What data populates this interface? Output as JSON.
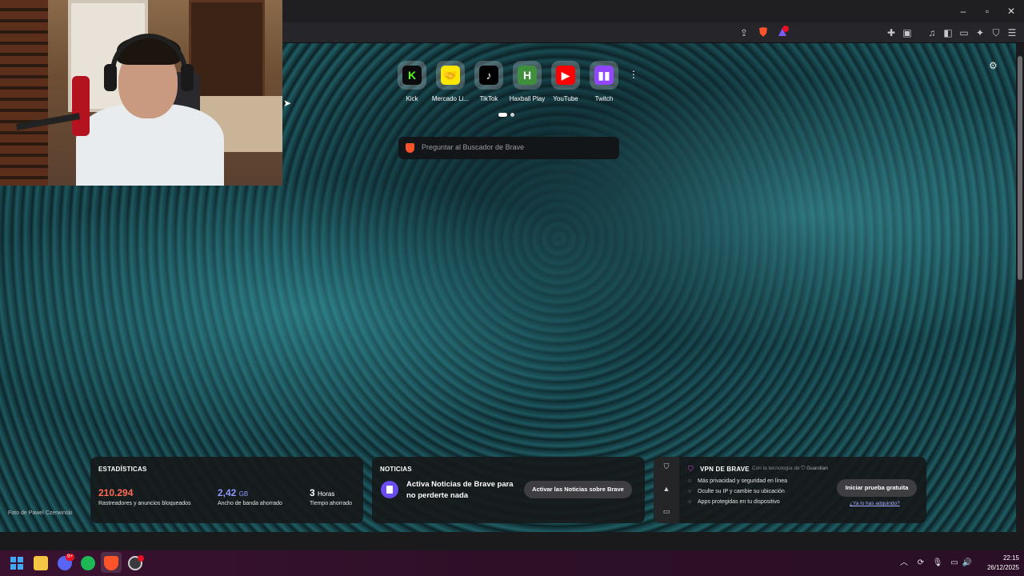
{
  "top_sites": [
    {
      "label": "Kick",
      "icon": "kick-icon",
      "glyph": "K",
      "color": "#53fc18",
      "bg": "#0b0b0b"
    },
    {
      "label": "Mercado Li...",
      "icon": "mercado-libre-icon",
      "glyph": "🤝",
      "color": "#2d3277",
      "bg": "#ffe600"
    },
    {
      "label": "TikTok",
      "icon": "tiktok-icon",
      "glyph": "♪",
      "color": "#ffffff",
      "bg": "#000000"
    },
    {
      "label": "Haxball Play",
      "icon": "haxball-icon",
      "glyph": "H",
      "color": "#ffffff",
      "bg": "#3f8f3c"
    },
    {
      "label": "YouTube",
      "icon": "youtube-icon",
      "glyph": "▶",
      "color": "#ffffff",
      "bg": "#ff0000"
    },
    {
      "label": "Twitch",
      "icon": "twitch-icon",
      "glyph": "▮▮",
      "color": "#ffffff",
      "bg": "#9146ff"
    }
  ],
  "search": {
    "placeholder": "Preguntar al Buscador de Brave"
  },
  "stats": {
    "title": "ESTADÍSTICAS",
    "blocked_value": "210.294",
    "blocked_label": "Rastreadores y anuncios bloqueados",
    "bandwidth_value": "2,42",
    "bandwidth_unit": "GB",
    "bandwidth_label": "Ancho de banda ahorrado",
    "time_value": "3",
    "time_unit": "Horas",
    "time_label": "Tiempo ahorrado",
    "colors": {
      "blocked": "#ff6b55",
      "bandwidth": "#8e98ff",
      "time": "#ffffff"
    }
  },
  "news": {
    "title": "NOTICIAS",
    "message": "Activa Noticias de Brave para no perderte nada",
    "button": "Activar las Noticias sobre Brave"
  },
  "vpn": {
    "title": "VPN DE BRAVE",
    "powered_by": "Con la tecnología de",
    "partner": "Guardian",
    "features": [
      "Más privacidad y seguridad en línea",
      "Oculte su IP y cambie su ubicación",
      "Apps protegidas en tu dispositivo"
    ],
    "button": "Iniciar prueba gratuita",
    "link": "¿Ya lo has adquirido?"
  },
  "photo_credit": "Foto de Pawel Czerwinski",
  "brave_badge": "1",
  "taskbar": {
    "discord_badge": "9+",
    "time": "22:15",
    "date": "26/12/2025"
  },
  "accent": "#fb542b"
}
